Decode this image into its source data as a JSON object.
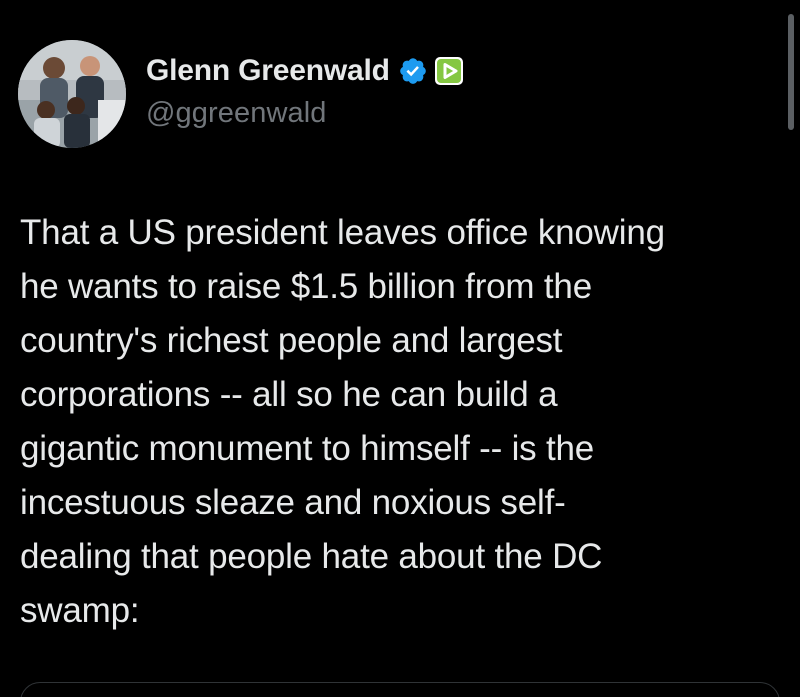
{
  "tweet": {
    "author": {
      "display_name": "Glenn Greenwald",
      "handle": "@ggreenwald",
      "avatar_icon": "profile-photo",
      "verified_icon": "verified-badge-icon",
      "affiliate_icon": "rumble-play-icon"
    },
    "text": "That a US president leaves office knowing\nhe wants to raise $1.5 billion from the\ncountry's richest people and largest\ncorporations -- all so he can build a\ngigantic monument to himself -- is the\nincestuous sleaze and noxious self-\ndealing that people hate about the DC\nswamp:"
  },
  "colors": {
    "background": "#000000",
    "text_primary": "#e7e9ea",
    "text_secondary": "#71767b",
    "verified_blue": "#1d9bf0",
    "rumble_green": "#85c742"
  }
}
